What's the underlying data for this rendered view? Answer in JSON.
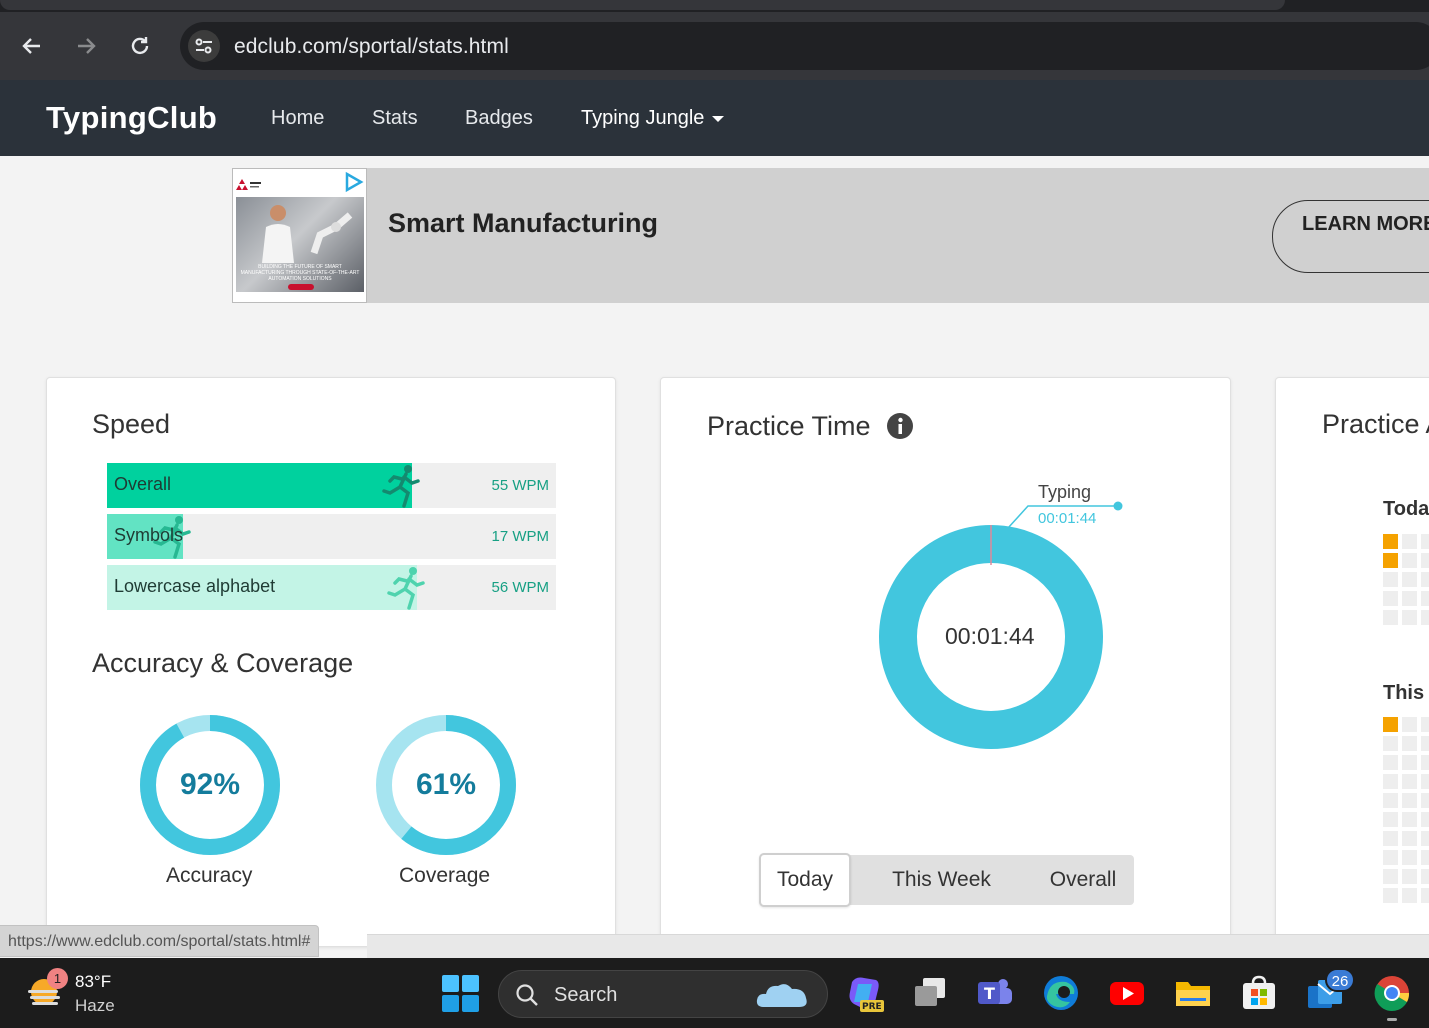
{
  "browser": {
    "url": "edclub.com/sportal/stats.html",
    "status_url": "https://www.edclub.com/sportal/stats.html#"
  },
  "nav": {
    "brand": "TypingClub",
    "links": [
      "Home",
      "Stats",
      "Badges",
      "Typing Jungle"
    ]
  },
  "ad": {
    "title": "Smart Manufacturing",
    "button": "LEARN MORE",
    "image_caption": "BUILDING THE FUTURE OF SMART MANUFACTURING THROUGH STATE-OF-THE-ART AUTOMATION SOLUTIONS"
  },
  "speed": {
    "title": "Speed",
    "bars": [
      {
        "label": "Overall",
        "value": "55 WPM",
        "fill": 0.68,
        "color": "#00d19e"
      },
      {
        "label": "Symbols",
        "value": "17 WPM",
        "fill": 0.17,
        "color": "#62e3c3"
      },
      {
        "label": "Lowercase alphabet",
        "value": "56 WPM",
        "fill": 0.69,
        "color": "#c3f4e6"
      }
    ]
  },
  "accuracy": {
    "title": "Accuracy & Coverage",
    "rings": [
      {
        "pct": "92%",
        "value": 0.92,
        "label": "Accuracy"
      },
      {
        "pct": "61%",
        "value": 0.61,
        "label": "Coverage"
      }
    ]
  },
  "practice_time": {
    "title": "Practice Time",
    "center": "00:01:44",
    "callout_label": "Typing",
    "callout_value": "00:01:44",
    "tabs": [
      "Today",
      "This Week",
      "Overall"
    ],
    "active_tab": "Today"
  },
  "practice_activity": {
    "title": "Practice A",
    "today_label": "Toda",
    "week_label": "This"
  },
  "taskbar": {
    "weather_temp": "83°F",
    "weather_cond": "Haze",
    "weather_badge": "1",
    "search": "Search",
    "mail_badge": "26"
  },
  "colors": {
    "accent": "#42c6de",
    "donut_dark": "#147c9c",
    "heat_on": "#f5a200"
  }
}
